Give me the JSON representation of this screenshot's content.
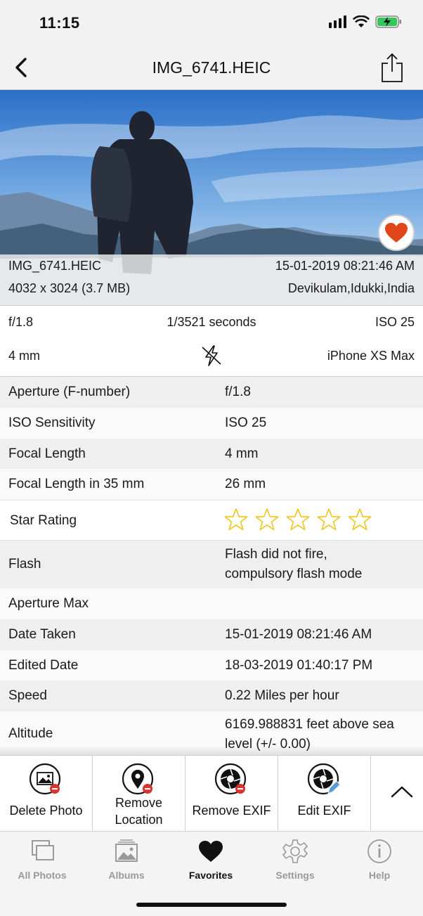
{
  "status_bar": {
    "time": "11:15"
  },
  "nav": {
    "title": "IMG_6741.HEIC"
  },
  "photo": {
    "file_name": "IMG_6741.HEIC",
    "date_time": "15-01-2019 08:21:46 AM",
    "dimensions": "4032 x 3024 (3.7 MB)",
    "location": "Devikulam,Idukki,India",
    "favorite": true
  },
  "summary": {
    "aperture": "f/1.8",
    "shutter": "1/3521 seconds",
    "iso": "ISO 25",
    "focal": "4 mm",
    "flash_icon": "flash-off-icon",
    "camera": "iPhone XS Max"
  },
  "details": [
    {
      "label": "Aperture (F-number)",
      "value": "f/1.8"
    },
    {
      "label": "ISO Sensitivity",
      "value": "ISO 25"
    },
    {
      "label": "Focal Length",
      "value": "4 mm"
    },
    {
      "label": "Focal Length in 35 mm",
      "value": "26 mm"
    },
    {
      "label": "Star Rating",
      "value": ""
    },
    {
      "label": "Flash",
      "value_line1": "Flash did not fire,",
      "value_line2": "compulsory flash mode"
    },
    {
      "label": "Aperture Max",
      "value": ""
    },
    {
      "label": "Date Taken",
      "value": "15-01-2019 08:21:46 AM"
    },
    {
      "label": "Edited Date",
      "value": "18-03-2019 01:40:17 PM"
    },
    {
      "label": "Speed",
      "value": "0.22 Miles per hour"
    },
    {
      "label": "Altitude",
      "value_line1": "6169.988831 feet above sea",
      "value_line2": "level (+/- 0.00)"
    }
  ],
  "star_rating": {
    "rating": 0,
    "max": 5
  },
  "toolbar": {
    "delete_photo": "Delete Photo",
    "remove_location_1": "Remove",
    "remove_location_2": "Location",
    "remove_exif": "Remove EXIF",
    "edit_exif": "Edit EXIF"
  },
  "tabs": [
    {
      "label": "All Photos",
      "icon": "photos-stack-icon",
      "active": false
    },
    {
      "label": "Albums",
      "icon": "albums-icon",
      "active": false
    },
    {
      "label": "Favorites",
      "icon": "heart-icon",
      "active": true
    },
    {
      "label": "Settings",
      "icon": "gear-icon",
      "active": false
    },
    {
      "label": "Help",
      "icon": "info-icon",
      "active": false
    }
  ],
  "colors": {
    "heart": "#e1461a",
    "star_outline": "#f0c419",
    "delete_badge": "#d9322e",
    "edit_pencil": "#5a9bd8"
  }
}
